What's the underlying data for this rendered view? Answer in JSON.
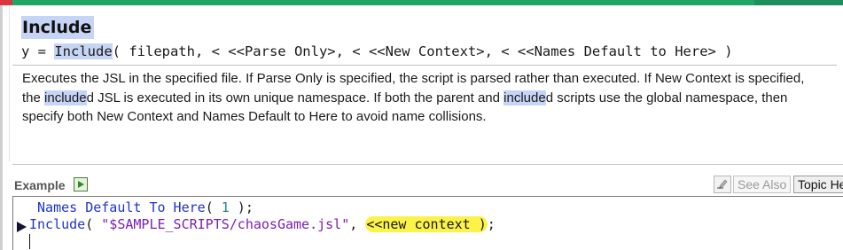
{
  "help": {
    "title": "Include",
    "syntax": {
      "prefix": "y = ",
      "function_name": "Include",
      "arguments": "( filepath, < <<Parse Only>, < <<New Context>, < <<Names Default to Here> )"
    },
    "description": {
      "line1": "Executes the JSL in the specified file. If Parse Only is specified, the script is parsed rather than executed. If New Context is specified,",
      "line2_a": "the ",
      "line2_hl": "include",
      "line2_b": "d JSL is executed in its own unique namespace. If both the parent and   ",
      "line2_hl2": "include",
      "line2_c": "d scripts use the global namespace, then",
      "line3": "specify both New Context and Names Default to Here to avoid name collisions."
    }
  },
  "example": {
    "label": "Example",
    "see_also_label": "See Also",
    "topic_help_label": "Topic He"
  },
  "code": {
    "line1": {
      "keyword": "Names Default To Here",
      "open": "( ",
      "number": "1",
      "close": " );"
    },
    "line2": {
      "keyword": "Include",
      "open": "( ",
      "string": "\"$SAMPLE_SCRIPTS/chaosGame.jsl\"",
      "sep": ", ",
      "message": "<<new context )",
      "end": ";"
    }
  },
  "icons": {
    "run": "run-script-icon",
    "edit": "edit-pencil-icon",
    "current_line": "current-line-arrow-icon"
  },
  "colors": {
    "keyword": "#1f35c8",
    "number": "#1a8a8a",
    "string": "#7a1fb0",
    "search_highlight": "#c6d4f5",
    "marker_highlight": "#fbf24a",
    "window_accent": "#21a566"
  }
}
